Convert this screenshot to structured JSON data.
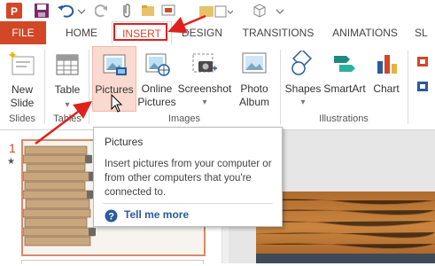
{
  "ribbon_tabs": {
    "file": "FILE",
    "home": "HOME",
    "insert": "INSERT",
    "design": "DESIGN",
    "transitions": "TRANSITIONS",
    "animations": "ANIMATIONS",
    "slideshow_partial": "SL"
  },
  "ribbon": {
    "new_slide": [
      "New",
      "Slide"
    ],
    "table": "Table",
    "pictures": "Pictures",
    "online_pictures": [
      "Online",
      "Pictures"
    ],
    "screenshot": "Screenshot",
    "photo_album": [
      "Photo",
      "Album"
    ],
    "shapes": "Shapes",
    "smartart": "SmartArt",
    "chart": "Chart",
    "groups": {
      "slides": "Slides",
      "tables": "Tables",
      "images": "Images",
      "illustrations": "Illustrations"
    }
  },
  "slide_pane": {
    "slide_number": "1",
    "star": "★"
  },
  "tooltip": {
    "title": "Pictures",
    "body": "Insert pictures from your computer or from other computers that you're connected to.",
    "help_link": "Tell me more"
  },
  "colors": {
    "accent": "#d24726",
    "annotation_red": "#e0201c",
    "link": "#2a5b9a",
    "highlight": "#f9d9d0"
  }
}
